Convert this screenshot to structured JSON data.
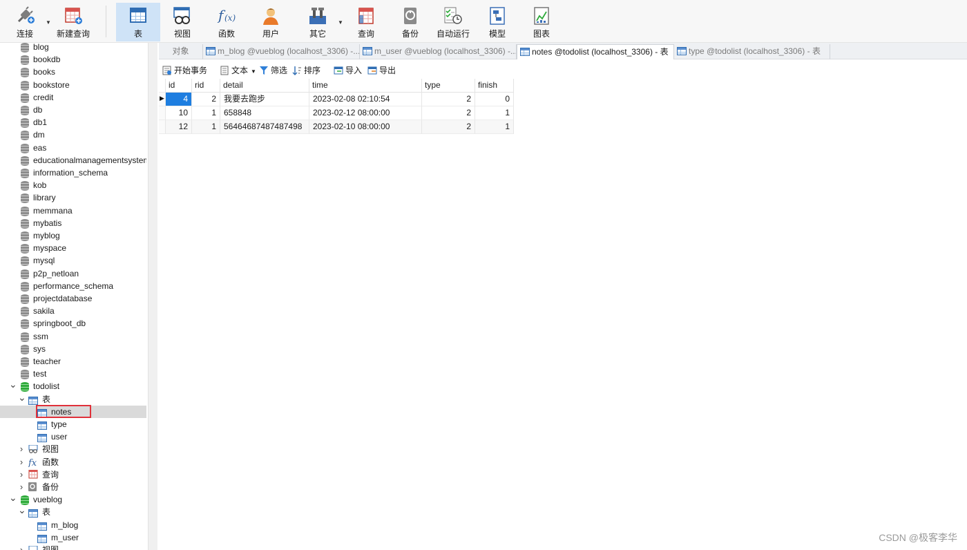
{
  "toolbar": {
    "buttons": [
      {
        "label": "连接",
        "icon": "plug-icon"
      },
      {
        "label": "新建查询",
        "icon": "new-query-icon"
      },
      {
        "label": "表",
        "icon": "table-icon",
        "active": true
      },
      {
        "label": "视图",
        "icon": "view-icon"
      },
      {
        "label": "函数",
        "icon": "function-icon"
      },
      {
        "label": "用户",
        "icon": "user-icon"
      },
      {
        "label": "其它",
        "icon": "tools-icon"
      },
      {
        "label": "查询",
        "icon": "query-icon"
      },
      {
        "label": "备份",
        "icon": "backup-icon"
      },
      {
        "label": "自动运行",
        "icon": "schedule-icon"
      },
      {
        "label": "模型",
        "icon": "model-icon"
      },
      {
        "label": "图表",
        "icon": "chart-icon"
      }
    ]
  },
  "tabs": {
    "object": "对象",
    "items": [
      {
        "label": "m_blog @vueblog (localhost_3306) -..."
      },
      {
        "label": "m_user @vueblog (localhost_3306) -..."
      },
      {
        "label": "notes @todolist (localhost_3306) - 表"
      },
      {
        "label": "type @todolist (localhost_3306) - 表"
      }
    ]
  },
  "subbar": {
    "begin_tx": "开始事务",
    "text": "文本",
    "filter": "筛选",
    "sort": "排序",
    "import": "导入",
    "export": "导出"
  },
  "tree": {
    "databases": [
      "blog",
      "bookdb",
      "books",
      "bookstore",
      "credit",
      "db",
      "db1",
      "dm",
      "eas",
      "educationalmanagementsystem",
      "information_schema",
      "kob",
      "library",
      "memmana",
      "mybatis",
      "myblog",
      "myspace",
      "mysql",
      "p2p_netloan",
      "performance_schema",
      "projectdatabase",
      "sakila",
      "springboot_db",
      "ssm",
      "sys",
      "teacher",
      "test"
    ],
    "todolist": {
      "name": "todolist",
      "tables_label": "表",
      "tables": [
        "notes",
        "type",
        "user"
      ],
      "views": "视图",
      "functions": "函数",
      "queries": "查询",
      "backups": "备份"
    },
    "vueblog": {
      "name": "vueblog",
      "tables_label": "表",
      "tables": [
        "m_blog",
        "m_user"
      ],
      "views": "视图"
    }
  },
  "grid": {
    "columns": [
      "id",
      "rid",
      "detail",
      "time",
      "type",
      "finish"
    ],
    "rows": [
      [
        "4",
        "2",
        "我要去跑步",
        "2023-02-08 02:10:54",
        "2",
        "0"
      ],
      [
        "10",
        "1",
        "658848",
        "2023-02-12 08:00:00",
        "2",
        "1"
      ],
      [
        "12",
        "1",
        "56464687487487498",
        "2023-02-10 08:00:00",
        "2",
        "1"
      ]
    ]
  },
  "watermark": "CSDN @极客李华"
}
